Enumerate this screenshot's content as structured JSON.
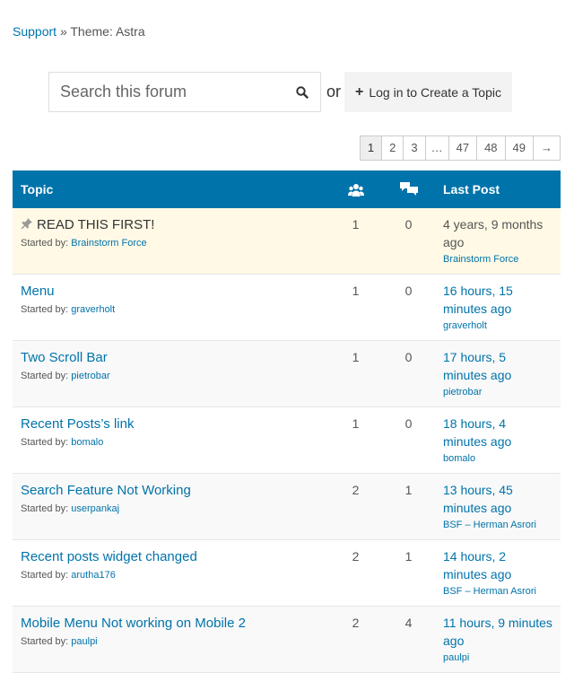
{
  "breadcrumb": {
    "root": "Support",
    "separator": "»",
    "current": "Theme: Astra"
  },
  "search": {
    "placeholder": "Search this forum",
    "value": "",
    "icon": "search-icon"
  },
  "or_text": "or",
  "login_button": {
    "plus": "+",
    "label": "Log in to Create a Topic"
  },
  "pagination": [
    "1",
    "2",
    "3",
    "…",
    "47",
    "48",
    "49",
    "→"
  ],
  "table": {
    "headers": {
      "topic": "Topic",
      "voices_icon": "users-icon",
      "replies_icon": "replies-icon",
      "last_post": "Last Post"
    },
    "started_prefix": "Started by:",
    "rows": [
      {
        "title": "READ THIS FIRST!",
        "author": "Brainstorm Force",
        "voices": "1",
        "replies": "0",
        "last_time": "4 years, 9 months ago",
        "last_author": "Brainstorm Force",
        "sticky": true
      },
      {
        "title": "Menu",
        "author": "graverholt",
        "voices": "1",
        "replies": "0",
        "last_time": "16 hours, 15 minutes ago",
        "last_author": "graverholt",
        "sticky": false
      },
      {
        "title": "Two Scroll Bar",
        "author": "pietrobar",
        "voices": "1",
        "replies": "0",
        "last_time": "17 hours, 5 minutes ago",
        "last_author": "pietrobar",
        "sticky": false
      },
      {
        "title": "Recent Posts’s link",
        "author": "bomalo",
        "voices": "1",
        "replies": "0",
        "last_time": "18 hours, 4 minutes ago",
        "last_author": "bomalo",
        "sticky": false
      },
      {
        "title": "Search Feature Not Working",
        "author": "userpankaj",
        "voices": "2",
        "replies": "1",
        "last_time": "13 hours, 45 minutes ago",
        "last_author": "BSF – Herman Asrori",
        "sticky": false
      },
      {
        "title": "Recent posts widget changed",
        "author": "arutha176",
        "voices": "2",
        "replies": "1",
        "last_time": "14 hours, 2 minutes ago",
        "last_author": "BSF – Herman Asrori",
        "sticky": false
      },
      {
        "title": "Mobile Menu Not working on Mobile 2",
        "author": "paulpi",
        "voices": "2",
        "replies": "4",
        "last_time": "11 hours, 9 minutes ago",
        "last_author": "paulpi",
        "sticky": false
      }
    ]
  },
  "colors": {
    "link": "#0073aa",
    "header_bg": "#0073aa",
    "sticky_bg": "#fff9e5"
  }
}
